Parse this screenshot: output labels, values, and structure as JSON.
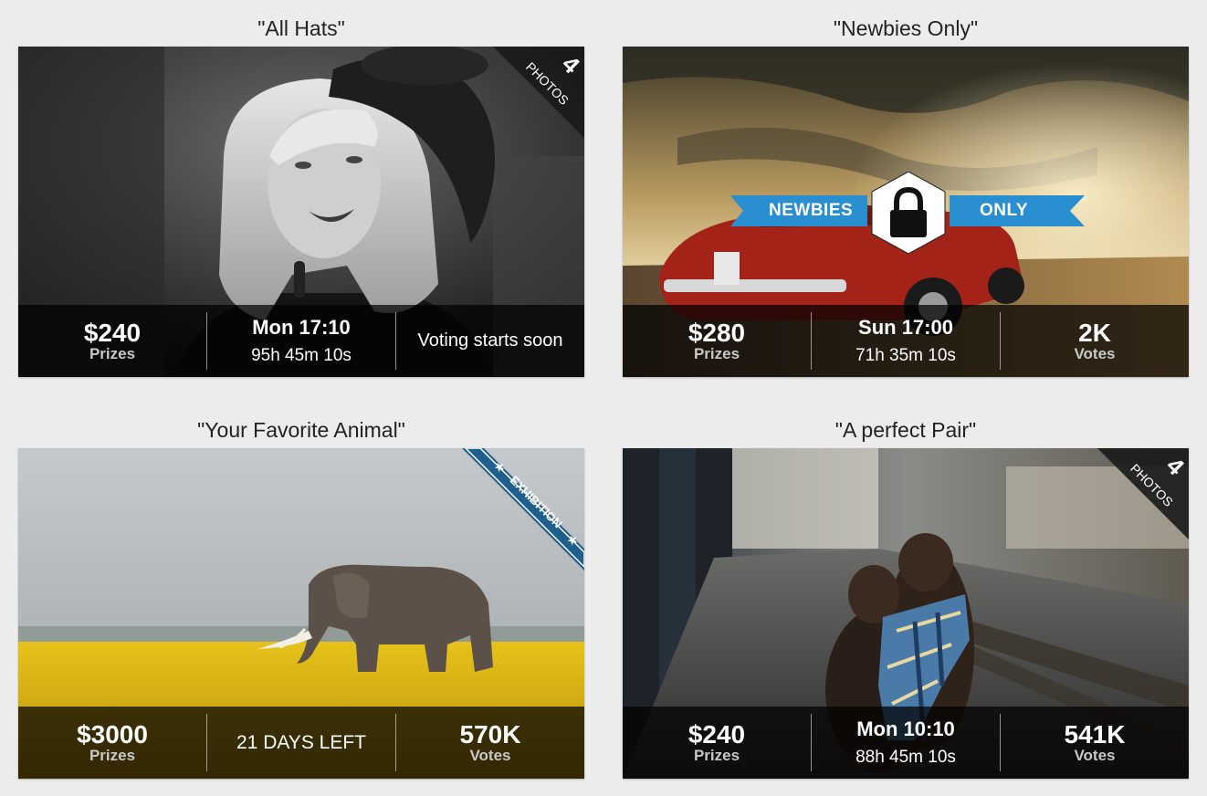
{
  "contests": [
    {
      "title": "\"All Hats\"",
      "photo_alt": "black and white portrait of woman in beret",
      "badge": {
        "count": "4",
        "label": "PHOTOS"
      },
      "prize": "$240",
      "prize_label": "Prizes",
      "time": "Mon 17:10",
      "countdown": "95h 45m 10s",
      "status": "Voting starts soon"
    },
    {
      "title": "\"Newbies Only\"",
      "photo_alt": "red muscle car under dramatic sky",
      "ribbon": {
        "left": "NEWBIES",
        "right": "ONLY",
        "icon": "lock-icon"
      },
      "prize": "$280",
      "prize_label": "Prizes",
      "time": "Sun 17:00",
      "countdown": "71h 35m 10s",
      "votes": "2K",
      "votes_label": "Votes"
    },
    {
      "title": "\"Your Favorite Animal\"",
      "photo_alt": "elephant in yellow flower field",
      "exhibition": "EXHIBITION",
      "prize": "$3000",
      "prize_label": "Prizes",
      "days_left": "21 DAYS LEFT",
      "votes": "570K",
      "votes_label": "Votes"
    },
    {
      "title": "\"A perfect Pair\"",
      "photo_alt": "two spaniel dogs with scarf on train platform",
      "badge": {
        "count": "4",
        "label": "PHOTOS"
      },
      "prize": "$240",
      "prize_label": "Prizes",
      "time": "Mon 10:10",
      "countdown": "88h 45m 10s",
      "votes": "541K",
      "votes_label": "Votes"
    }
  ],
  "colors": {
    "ribbon_blue": "#2a8fd0",
    "exhibition_blue": "#1e5f8e",
    "background": "#ececec"
  }
}
